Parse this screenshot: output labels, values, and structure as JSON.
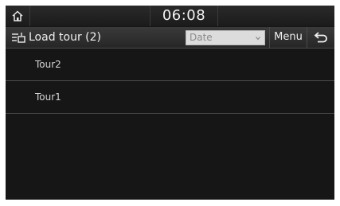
{
  "status_bar": {
    "home_icon": "home-icon",
    "time": "06:08"
  },
  "header": {
    "icon": "load-tour-icon",
    "title": "Load tour (2)",
    "sort": {
      "selected": "Date",
      "arrow_icon": "chevron-down-icon"
    },
    "menu_label": "Menu",
    "back_icon": "back-arrow-icon"
  },
  "tours": [
    {
      "label": "Tour2"
    },
    {
      "label": "Tour1"
    }
  ],
  "colors": {
    "background": "#161616",
    "bar": "#2a2a2a",
    "text": "#f0f0f0",
    "select_bg": "#dcdcdc",
    "divider": "#4b4b4b"
  }
}
